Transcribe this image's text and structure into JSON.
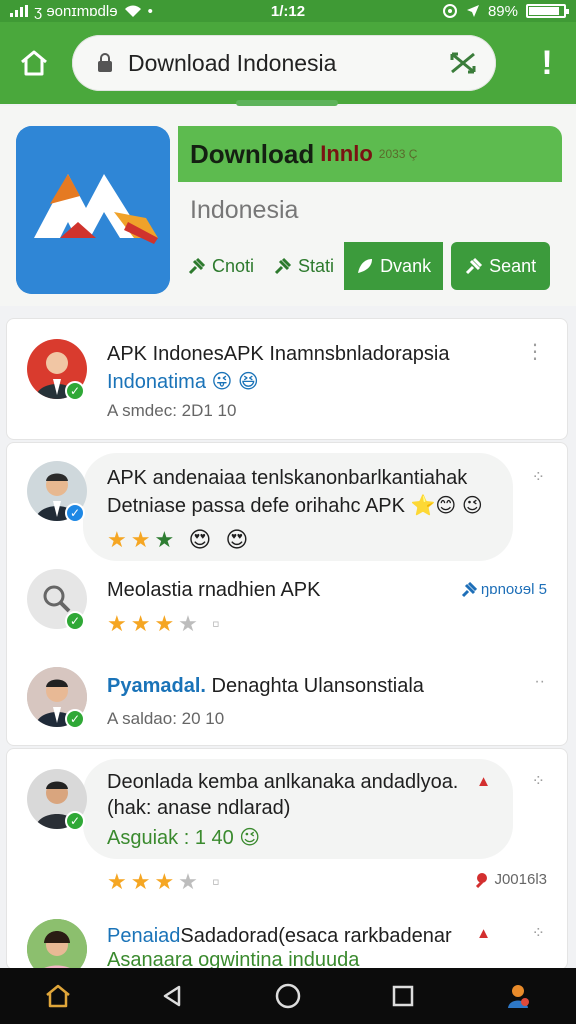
{
  "status": {
    "carrier": "ʒ ɘonɪmɒdlɘ",
    "time": "1/:12",
    "battery": "89%",
    "battery_level": 0.89
  },
  "browser": {
    "url": "Download Indonesia",
    "home_icon": "home-icon",
    "lock_icon": "lock-icon",
    "tabs_icon": "tabs-icon",
    "alert_label": "!"
  },
  "app": {
    "title_main": "Download",
    "title_accent": "Innlo",
    "title_small": "2033 Ç",
    "subtitle": "Indonesia",
    "actions": [
      {
        "label": "Cnoti",
        "icon": "pin-icon"
      },
      {
        "label": "Stati",
        "icon": "pin-icon"
      },
      {
        "label": "Dvank",
        "icon": "leaf-icon"
      },
      {
        "label": "Seant",
        "icon": "pin-icon"
      }
    ],
    "brand_colors": {
      "icon_bg": "#2f86d6",
      "title_bar": "#5dbb4f",
      "button": "#3c9b3c"
    }
  },
  "feed": {
    "card1": {
      "line1": "APK IndonesAPK Inamnsbnladorapsia",
      "line2": "Indonatima 😜 😆",
      "meta": "A smdec: 2D1 10"
    },
    "card2": {
      "item1": {
        "line1": "APK andenaiaa tenlskanonbarlkantiahak",
        "line2": "Detniase passa defe orihahc APK ⭐😊 😉",
        "reactions": "😍 😍",
        "rating": 3
      },
      "item2": {
        "line1": "Meolastia rnadhien APK",
        "tag": "ŋɒnoʊɘl 5",
        "rating": 3
      },
      "item3": {
        "name": "Pyamadal.",
        "line1": "Denaghta Ulansonstiala",
        "meta": "A saldao: 20 10"
      }
    },
    "card3": {
      "item1": {
        "line1": "Deonlada kemba anlkanaka andadlyoa.",
        "line2": "(hak: anase ndlarad)",
        "line3": "Asguiak : 1 40 😉",
        "rating": 3,
        "tag": "J0016l3"
      },
      "item2": {
        "name": "Penaiad",
        "line1": "Sadadorad(esaca rarkbadenar",
        "line2": "Asanaara ogwintina induuda"
      }
    }
  },
  "navbar": {
    "icons": [
      "home-icon",
      "back-icon",
      "circle-icon",
      "square-icon",
      "profile-icon"
    ]
  }
}
